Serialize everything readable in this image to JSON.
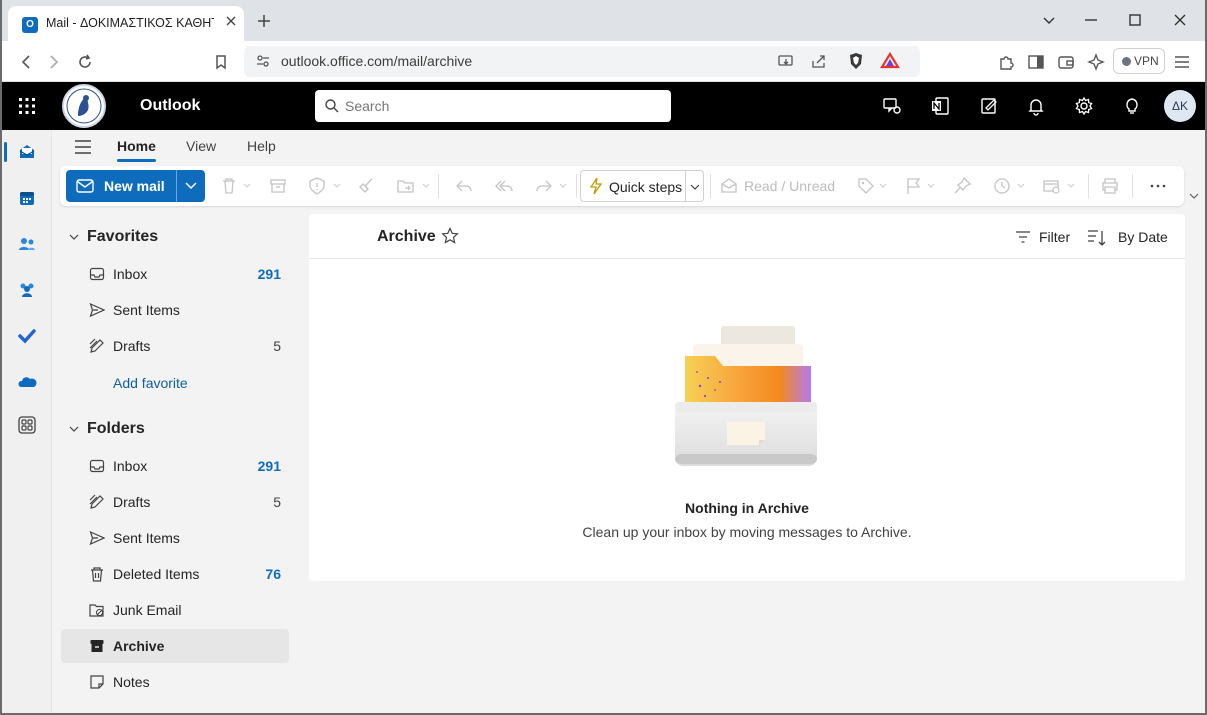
{
  "browser": {
    "tab_title": "Mail - ΔΟΚΙΜΑΣΤΙΚΟΣ ΚΑΘΗΤΗΣ",
    "url": "outlook.office.com/mail/archive",
    "vpn_label": "VPN"
  },
  "header": {
    "app_name": "Outlook",
    "search_placeholder": "Search",
    "avatar_initials": "ΔΚ"
  },
  "menu_tabs": [
    "Home",
    "View",
    "Help"
  ],
  "ribbon": {
    "new_mail": "New mail",
    "quick_steps": "Quick steps",
    "read_unread": "Read / Unread"
  },
  "favorites": {
    "title": "Favorites",
    "items": [
      {
        "label": "Inbox",
        "count": "291"
      },
      {
        "label": "Sent Items",
        "count": ""
      },
      {
        "label": "Drafts",
        "count": "5"
      }
    ],
    "add_favorite": "Add favorite"
  },
  "folders": {
    "title": "Folders",
    "items": [
      {
        "label": "Inbox",
        "count": "291"
      },
      {
        "label": "Drafts",
        "count": "5"
      },
      {
        "label": "Sent Items",
        "count": ""
      },
      {
        "label": "Deleted Items",
        "count": "76"
      },
      {
        "label": "Junk Email",
        "count": ""
      },
      {
        "label": "Archive",
        "count": ""
      },
      {
        "label": "Notes",
        "count": ""
      }
    ]
  },
  "list": {
    "title": "Archive",
    "filter": "Filter",
    "sort": "By Date",
    "empty_title": "Nothing in Archive",
    "empty_subtitle": "Clean up your inbox by moving messages to Archive."
  },
  "colors": {
    "accent": "#0f6cbd",
    "header_bg": "#000000",
    "count_blue": "#0f6cbd"
  },
  "icons": [
    "outlook-favicon",
    "close-icon",
    "plus-icon",
    "back-icon",
    "forward-icon",
    "reload-icon",
    "bookmark-icon",
    "site-settings-icon",
    "install-icon",
    "share-icon",
    "brave-shield-icon",
    "brave-rewards-icon",
    "extensions-icon",
    "sidebar-icon",
    "wallet-icon",
    "leo-ai-icon",
    "menu-icon",
    "waffle-icon",
    "search-icon",
    "meet-now-icon",
    "onenote-icon",
    "whiteboard-icon",
    "bell-icon",
    "gear-icon",
    "lightbulb-icon",
    "mail-icon",
    "calendar-icon",
    "people-icon",
    "teams-icon",
    "todo-icon",
    "onedrive-icon",
    "apps-icon",
    "hamburger-icon",
    "trash-icon",
    "archive-icon",
    "report-icon",
    "sweep-icon",
    "move-icon",
    "reply-icon",
    "reply-all-icon",
    "forward-mail-icon",
    "lightning-icon",
    "envelope-open-icon",
    "tag-icon",
    "flag-icon",
    "pin-icon",
    "clock-icon",
    "rules-icon",
    "print-icon",
    "more-icon",
    "chevron-down-icon",
    "inbox-icon",
    "send-icon",
    "drafts-icon",
    "junk-icon",
    "notes-icon",
    "star-icon",
    "filter-icon",
    "sort-icon"
  ]
}
